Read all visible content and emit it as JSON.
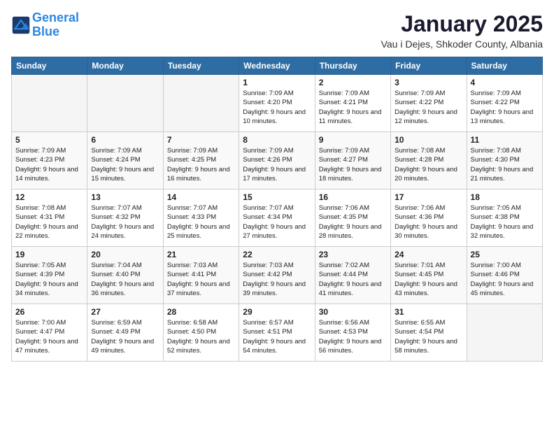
{
  "logo": {
    "line1": "General",
    "line2": "Blue"
  },
  "title": "January 2025",
  "subtitle": "Vau i Dejes, Shkoder County, Albania",
  "weekdays": [
    "Sunday",
    "Monday",
    "Tuesday",
    "Wednesday",
    "Thursday",
    "Friday",
    "Saturday"
  ],
  "weeks": [
    [
      {
        "day": "",
        "sunrise": "",
        "sunset": "",
        "daylight": ""
      },
      {
        "day": "",
        "sunrise": "",
        "sunset": "",
        "daylight": ""
      },
      {
        "day": "",
        "sunrise": "",
        "sunset": "",
        "daylight": ""
      },
      {
        "day": "1",
        "sunrise": "Sunrise: 7:09 AM",
        "sunset": "Sunset: 4:20 PM",
        "daylight": "Daylight: 9 hours and 10 minutes."
      },
      {
        "day": "2",
        "sunrise": "Sunrise: 7:09 AM",
        "sunset": "Sunset: 4:21 PM",
        "daylight": "Daylight: 9 hours and 11 minutes."
      },
      {
        "day": "3",
        "sunrise": "Sunrise: 7:09 AM",
        "sunset": "Sunset: 4:22 PM",
        "daylight": "Daylight: 9 hours and 12 minutes."
      },
      {
        "day": "4",
        "sunrise": "Sunrise: 7:09 AM",
        "sunset": "Sunset: 4:22 PM",
        "daylight": "Daylight: 9 hours and 13 minutes."
      }
    ],
    [
      {
        "day": "5",
        "sunrise": "Sunrise: 7:09 AM",
        "sunset": "Sunset: 4:23 PM",
        "daylight": "Daylight: 9 hours and 14 minutes."
      },
      {
        "day": "6",
        "sunrise": "Sunrise: 7:09 AM",
        "sunset": "Sunset: 4:24 PM",
        "daylight": "Daylight: 9 hours and 15 minutes."
      },
      {
        "day": "7",
        "sunrise": "Sunrise: 7:09 AM",
        "sunset": "Sunset: 4:25 PM",
        "daylight": "Daylight: 9 hours and 16 minutes."
      },
      {
        "day": "8",
        "sunrise": "Sunrise: 7:09 AM",
        "sunset": "Sunset: 4:26 PM",
        "daylight": "Daylight: 9 hours and 17 minutes."
      },
      {
        "day": "9",
        "sunrise": "Sunrise: 7:09 AM",
        "sunset": "Sunset: 4:27 PM",
        "daylight": "Daylight: 9 hours and 18 minutes."
      },
      {
        "day": "10",
        "sunrise": "Sunrise: 7:08 AM",
        "sunset": "Sunset: 4:28 PM",
        "daylight": "Daylight: 9 hours and 20 minutes."
      },
      {
        "day": "11",
        "sunrise": "Sunrise: 7:08 AM",
        "sunset": "Sunset: 4:30 PM",
        "daylight": "Daylight: 9 hours and 21 minutes."
      }
    ],
    [
      {
        "day": "12",
        "sunrise": "Sunrise: 7:08 AM",
        "sunset": "Sunset: 4:31 PM",
        "daylight": "Daylight: 9 hours and 22 minutes."
      },
      {
        "day": "13",
        "sunrise": "Sunrise: 7:07 AM",
        "sunset": "Sunset: 4:32 PM",
        "daylight": "Daylight: 9 hours and 24 minutes."
      },
      {
        "day": "14",
        "sunrise": "Sunrise: 7:07 AM",
        "sunset": "Sunset: 4:33 PM",
        "daylight": "Daylight: 9 hours and 25 minutes."
      },
      {
        "day": "15",
        "sunrise": "Sunrise: 7:07 AM",
        "sunset": "Sunset: 4:34 PM",
        "daylight": "Daylight: 9 hours and 27 minutes."
      },
      {
        "day": "16",
        "sunrise": "Sunrise: 7:06 AM",
        "sunset": "Sunset: 4:35 PM",
        "daylight": "Daylight: 9 hours and 28 minutes."
      },
      {
        "day": "17",
        "sunrise": "Sunrise: 7:06 AM",
        "sunset": "Sunset: 4:36 PM",
        "daylight": "Daylight: 9 hours and 30 minutes."
      },
      {
        "day": "18",
        "sunrise": "Sunrise: 7:05 AM",
        "sunset": "Sunset: 4:38 PM",
        "daylight": "Daylight: 9 hours and 32 minutes."
      }
    ],
    [
      {
        "day": "19",
        "sunrise": "Sunrise: 7:05 AM",
        "sunset": "Sunset: 4:39 PM",
        "daylight": "Daylight: 9 hours and 34 minutes."
      },
      {
        "day": "20",
        "sunrise": "Sunrise: 7:04 AM",
        "sunset": "Sunset: 4:40 PM",
        "daylight": "Daylight: 9 hours and 36 minutes."
      },
      {
        "day": "21",
        "sunrise": "Sunrise: 7:03 AM",
        "sunset": "Sunset: 4:41 PM",
        "daylight": "Daylight: 9 hours and 37 minutes."
      },
      {
        "day": "22",
        "sunrise": "Sunrise: 7:03 AM",
        "sunset": "Sunset: 4:42 PM",
        "daylight": "Daylight: 9 hours and 39 minutes."
      },
      {
        "day": "23",
        "sunrise": "Sunrise: 7:02 AM",
        "sunset": "Sunset: 4:44 PM",
        "daylight": "Daylight: 9 hours and 41 minutes."
      },
      {
        "day": "24",
        "sunrise": "Sunrise: 7:01 AM",
        "sunset": "Sunset: 4:45 PM",
        "daylight": "Daylight: 9 hours and 43 minutes."
      },
      {
        "day": "25",
        "sunrise": "Sunrise: 7:00 AM",
        "sunset": "Sunset: 4:46 PM",
        "daylight": "Daylight: 9 hours and 45 minutes."
      }
    ],
    [
      {
        "day": "26",
        "sunrise": "Sunrise: 7:00 AM",
        "sunset": "Sunset: 4:47 PM",
        "daylight": "Daylight: 9 hours and 47 minutes."
      },
      {
        "day": "27",
        "sunrise": "Sunrise: 6:59 AM",
        "sunset": "Sunset: 4:49 PM",
        "daylight": "Daylight: 9 hours and 49 minutes."
      },
      {
        "day": "28",
        "sunrise": "Sunrise: 6:58 AM",
        "sunset": "Sunset: 4:50 PM",
        "daylight": "Daylight: 9 hours and 52 minutes."
      },
      {
        "day": "29",
        "sunrise": "Sunrise: 6:57 AM",
        "sunset": "Sunset: 4:51 PM",
        "daylight": "Daylight: 9 hours and 54 minutes."
      },
      {
        "day": "30",
        "sunrise": "Sunrise: 6:56 AM",
        "sunset": "Sunset: 4:53 PM",
        "daylight": "Daylight: 9 hours and 56 minutes."
      },
      {
        "day": "31",
        "sunrise": "Sunrise: 6:55 AM",
        "sunset": "Sunset: 4:54 PM",
        "daylight": "Daylight: 9 hours and 58 minutes."
      },
      {
        "day": "",
        "sunrise": "",
        "sunset": "",
        "daylight": ""
      }
    ]
  ]
}
